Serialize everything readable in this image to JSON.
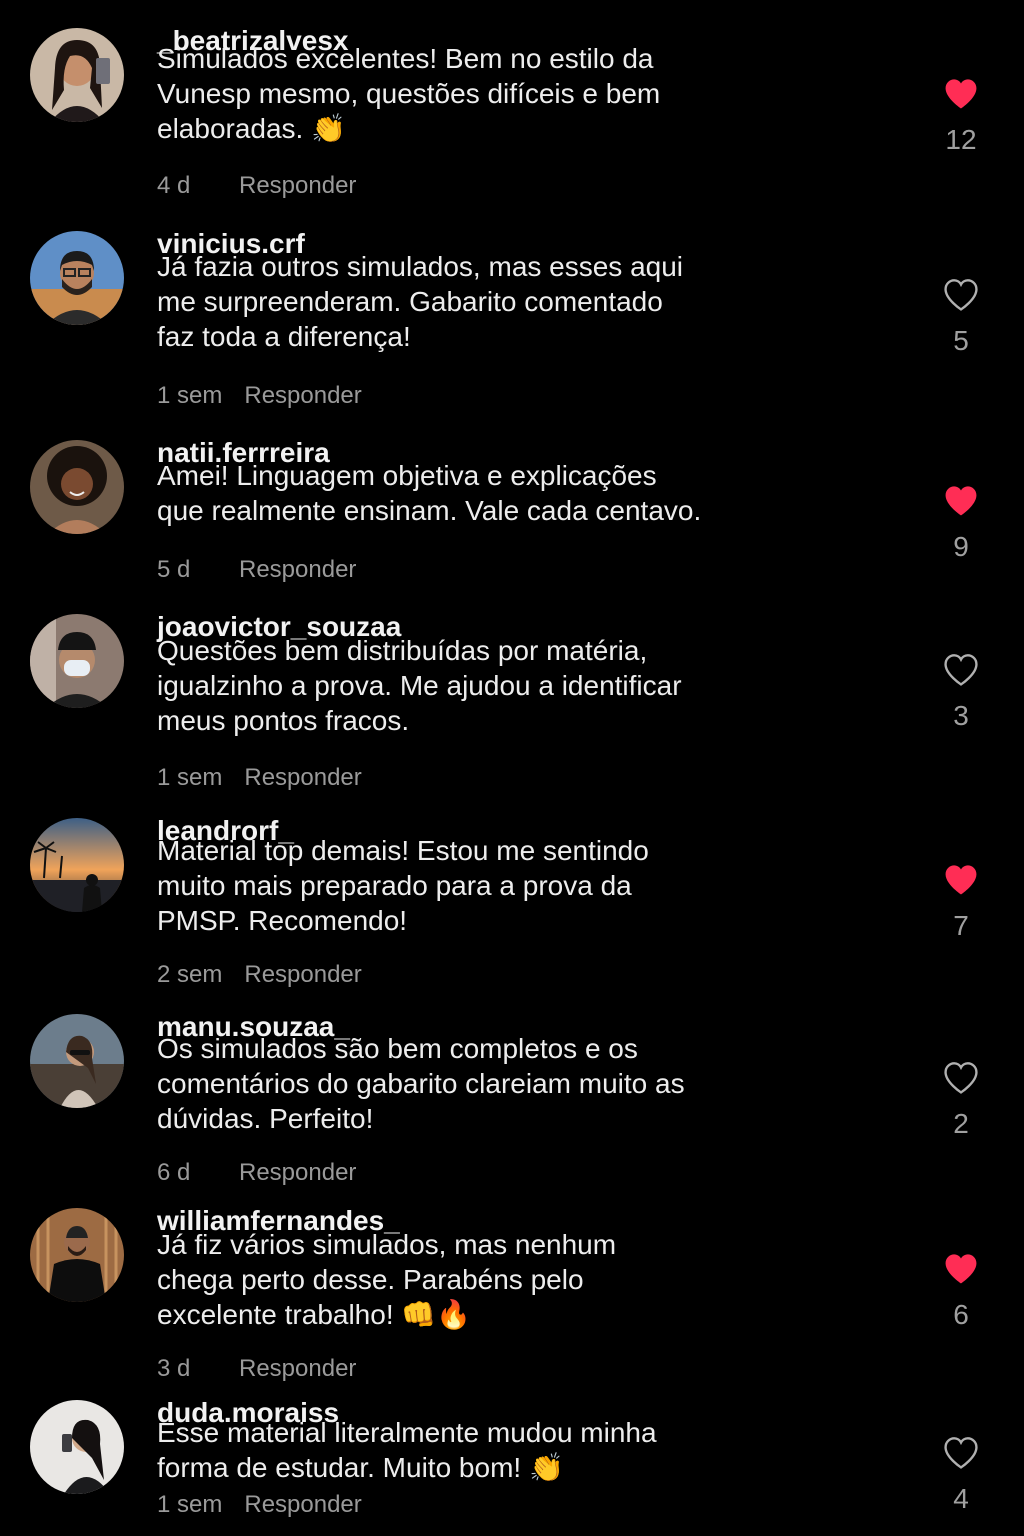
{
  "colors": {
    "background": "#000000",
    "like_active": "#ff2d55",
    "muted": "#9a9a9a"
  },
  "reply_label": "Responder",
  "comments": [
    {
      "username": "_beatrizalvesx",
      "lines": [
        "Simulados excelentes! Bem no estilo da",
        "Vunesp mesmo, questões difíceis e bem",
        "elaboradas. 👏"
      ],
      "time": "4 d",
      "reply": "Responder",
      "likes": "12",
      "liked": true,
      "avatar": "woman-dark-hair"
    },
    {
      "username": "vinicius.crf",
      "lines": [
        "Já fazia outros simulados, mas esses aqui",
        "me surpreenderam. Gabarito comentado",
        "faz toda a diferença!"
      ],
      "time": "1 sem",
      "reply": "Responder",
      "likes": "5",
      "liked": false,
      "avatar": "man-glasses-beard"
    },
    {
      "username": "natii.ferrreira",
      "lines": [
        "Amei! Linguagem objetiva e explicações",
        "que realmente ensinam. Vale cada centavo."
      ],
      "time": "5 d",
      "reply": "Responder",
      "likes": "9",
      "liked": true,
      "avatar": "woman-curly-hair"
    },
    {
      "username": "joaovictor_souzaa",
      "lines": [
        "Questões bem distribuídas por matéria,",
        "igualzinho a prova. Me ajudou a identificar",
        "meus pontos fracos."
      ],
      "time": "1 sem",
      "reply": "Responder",
      "likes": "3",
      "liked": false,
      "avatar": "man-cap-mask"
    },
    {
      "username": "leandrorf_",
      "lines": [
        "Material top demais! Estou me sentindo",
        "muito mais preparado para a prova da",
        "PMSP. Recomendo!"
      ],
      "time": "2 sem",
      "reply": "Responder",
      "likes": "7",
      "liked": true,
      "avatar": "sunset-palm-trees"
    },
    {
      "username": "manu.souzaa_",
      "lines": [
        "Os simulados são bem completos e os",
        "comentários do gabarito clareiam muito as",
        "dúvidas. Perfeito!"
      ],
      "time": "6 d",
      "reply": "Responder",
      "likes": "2",
      "liked": false,
      "avatar": "woman-sunglasses"
    },
    {
      "username": "williamfernandes_",
      "lines": [
        "Já fiz vários simulados, mas nenhum",
        "chega perto desse. Parabéns pelo",
        "excelente trabalho! 👊🔥"
      ],
      "time": "3 d",
      "reply": "Responder",
      "likes": "6",
      "liked": true,
      "avatar": "man-black-shirt"
    },
    {
      "username": "duda.moraiss",
      "lines": [
        "Esse material literalmente mudou minha",
        "forma de estudar. Muito bom! 👏"
      ],
      "time": "1 sem",
      "reply": "Responder",
      "likes": "4",
      "liked": false,
      "avatar": "woman-mirror-selfie"
    }
  ]
}
